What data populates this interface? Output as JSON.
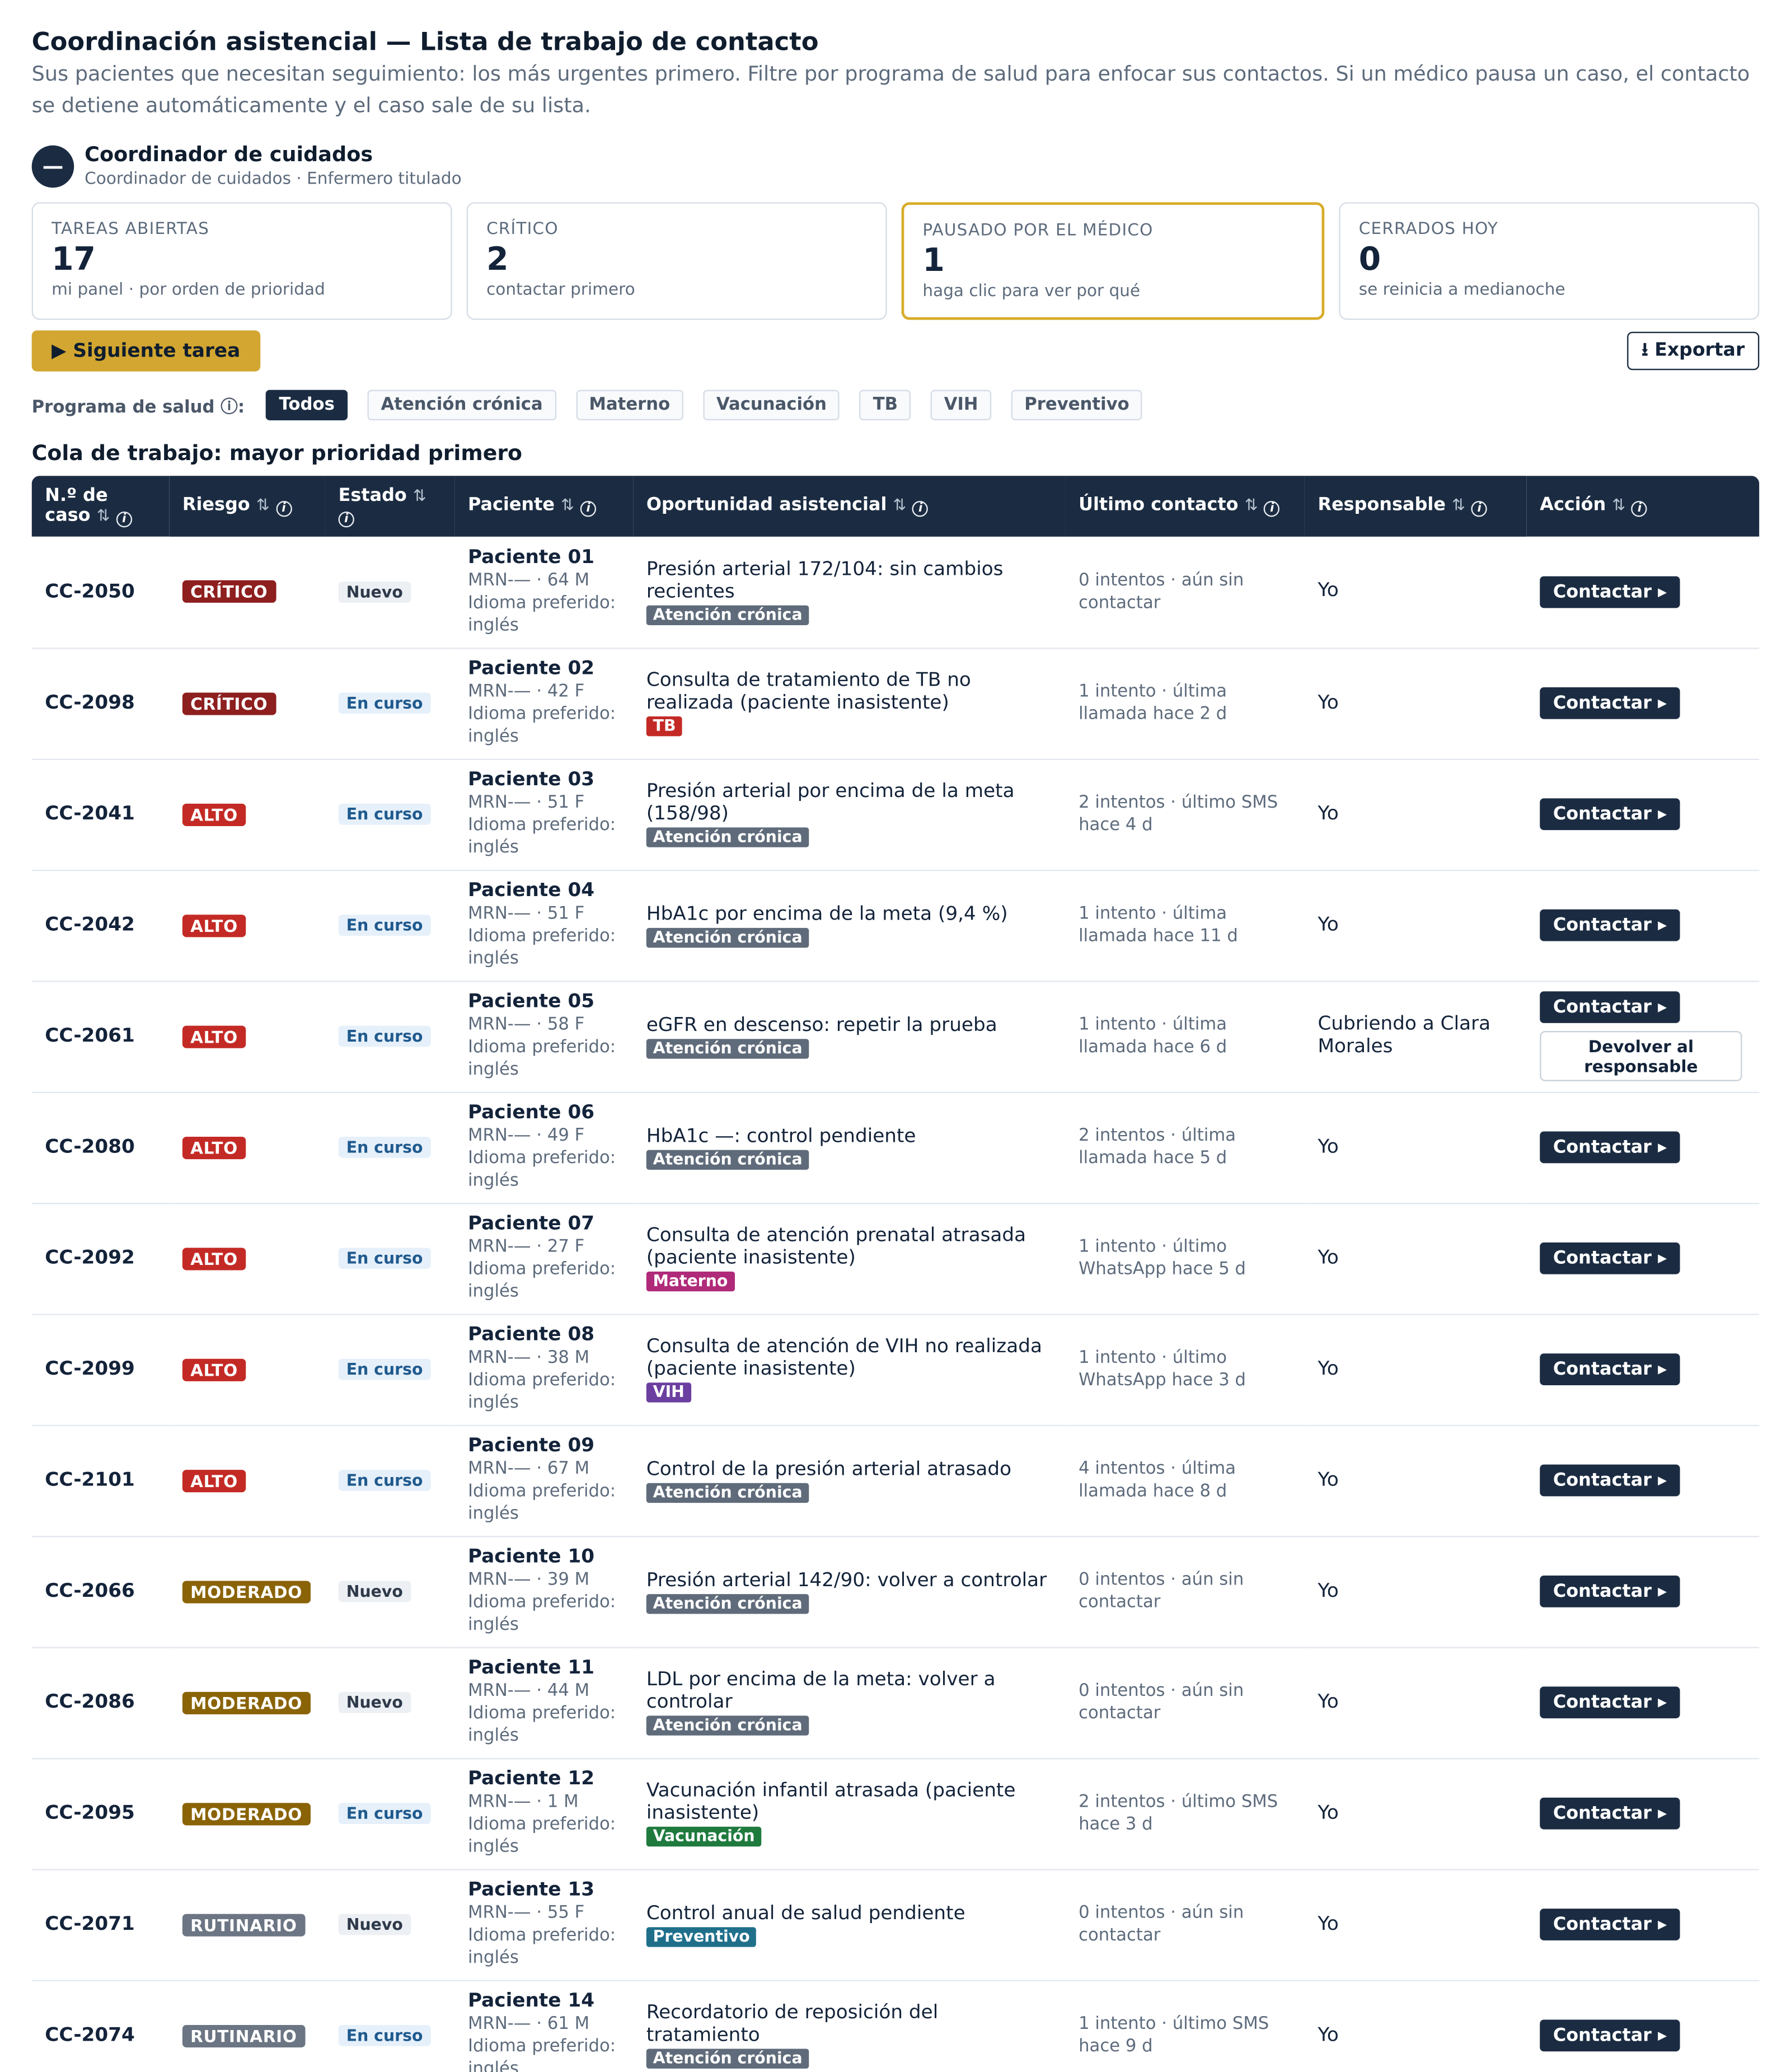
{
  "header": {
    "title": "Coordinación asistencial — Lista de trabajo de contacto",
    "subtitle": "Sus pacientes que necesitan seguimiento: los más urgentes primero. Filtre por programa de salud para enfocar sus contactos. Si un médico pausa un caso, el contacto se detiene automáticamente y el caso sale de su lista."
  },
  "role": {
    "initial": "—",
    "name": "Coordinador de cuidados",
    "detail": "Coordinador de cuidados · Enfermero titulado"
  },
  "stats": [
    {
      "label": "TAREAS ABIERTAS",
      "value": "17",
      "hint": "mi panel · por orden de prioridad"
    },
    {
      "label": "CRÍTICO",
      "value": "2",
      "hint": "contactar primero"
    },
    {
      "label": "PAUSADO POR EL MÉDICO",
      "value": "1",
      "hint": "haga clic para ver por qué"
    },
    {
      "label": "CERRADOS HOY",
      "value": "0",
      "hint": "se reinicia a medianoche"
    }
  ],
  "actions": {
    "next_task": "▶ Siguiente tarea",
    "export": "⭳ Exportar"
  },
  "filters": {
    "label": "Programa de salud ⓘ:",
    "chips": [
      "Todos",
      "Atención crónica",
      "Materno",
      "Vacunación",
      "TB",
      "VIH",
      "Preventivo"
    ],
    "active": "Todos"
  },
  "queue_title": "Cola de trabajo: mayor prioridad primero",
  "table": {
    "headers": {
      "case": "N.º de caso",
      "risk": "Riesgo",
      "status": "Estado",
      "patient": "Paciente",
      "opportunity": "Oportunidad asistencial",
      "last_contact": "Último contacto",
      "owner": "Responsable",
      "action": "Acción"
    },
    "sort_glyph": "⇅",
    "info_glyph": "i",
    "contact_label": "Contactar ▸",
    "return_label": "Devolver al responsable",
    "program_colors": {
      "Atención crónica": "#5f6b7a",
      "TB": "#c42a25",
      "Materno": "#b02a7a",
      "VIH": "#6b3fa0",
      "Vacunación": "#1f7a3e",
      "Preventivo": "#1f6f8b"
    },
    "rows": [
      {
        "case": "CC-2050",
        "risk": "CRÍTICO",
        "risk_class": "critico",
        "status": "Nuevo",
        "status_class": "nuevo",
        "patient": "Paciente 01",
        "mrn": "MRN-— · 64 M",
        "lang": "Idioma preferido: inglés",
        "opportunity": "Presión arterial 172/104: sin cambios recientes",
        "program": "Atención crónica",
        "last_contact": "0 intentos · aún sin contactar",
        "owner": "Yo"
      },
      {
        "case": "CC-2098",
        "risk": "CRÍTICO",
        "risk_class": "critico",
        "status": "En curso",
        "status_class": "curso",
        "patient": "Paciente 02",
        "mrn": "MRN-— · 42 F",
        "lang": "Idioma preferido: inglés",
        "opportunity": "Consulta de tratamiento de TB no realizada (paciente inasistente)",
        "program": "TB",
        "last_contact": "1 intento · última llamada hace 2 d",
        "owner": "Yo"
      },
      {
        "case": "CC-2041",
        "risk": "ALTO",
        "risk_class": "alto",
        "status": "En curso",
        "status_class": "curso",
        "patient": "Paciente 03",
        "mrn": "MRN-— · 51 F",
        "lang": "Idioma preferido: inglés",
        "opportunity": "Presión arterial por encima de la meta (158/98)",
        "program": "Atención crónica",
        "last_contact": "2 intentos · último SMS hace 4 d",
        "owner": "Yo"
      },
      {
        "case": "CC-2042",
        "risk": "ALTO",
        "risk_class": "alto",
        "status": "En curso",
        "status_class": "curso",
        "patient": "Paciente 04",
        "mrn": "MRN-— · 51 F",
        "lang": "Idioma preferido: inglés",
        "opportunity": "HbA1c por encima de la meta (9,4 %)",
        "program": "Atención crónica",
        "last_contact": "1 intento · última llamada hace 11 d",
        "owner": "Yo"
      },
      {
        "case": "CC-2061",
        "risk": "ALTO",
        "risk_class": "alto",
        "status": "En curso",
        "status_class": "curso",
        "patient": "Paciente 05",
        "mrn": "MRN-— · 58 F",
        "lang": "Idioma preferido: inglés",
        "opportunity": "eGFR en descenso: repetir la prueba",
        "program": "Atención crónica",
        "last_contact": "1 intento · última llamada hace 6 d",
        "owner": "Cubriendo a Clara Morales",
        "covering": true
      },
      {
        "case": "CC-2080",
        "risk": "ALTO",
        "risk_class": "alto",
        "status": "En curso",
        "status_class": "curso",
        "patient": "Paciente 06",
        "mrn": "MRN-— · 49 F",
        "lang": "Idioma preferido: inglés",
        "opportunity": "HbA1c —: control pendiente",
        "program": "Atención crónica",
        "last_contact": "2 intentos · última llamada hace 5 d",
        "owner": "Yo"
      },
      {
        "case": "CC-2092",
        "risk": "ALTO",
        "risk_class": "alto",
        "status": "En curso",
        "status_class": "curso",
        "patient": "Paciente 07",
        "mrn": "MRN-— · 27 F",
        "lang": "Idioma preferido: inglés",
        "opportunity": "Consulta de atención prenatal atrasada (paciente inasistente)",
        "program": "Materno",
        "last_contact": "1 intento · último WhatsApp hace 5 d",
        "owner": "Yo"
      },
      {
        "case": "CC-2099",
        "risk": "ALTO",
        "risk_class": "alto",
        "status": "En curso",
        "status_class": "curso",
        "patient": "Paciente 08",
        "mrn": "MRN-— · 38 M",
        "lang": "Idioma preferido: inglés",
        "opportunity": "Consulta de atención de VIH no realizada (paciente inasistente)",
        "program": "VIH",
        "last_contact": "1 intento · último WhatsApp hace 3 d",
        "owner": "Yo"
      },
      {
        "case": "CC-2101",
        "risk": "ALTO",
        "risk_class": "alto",
        "status": "En curso",
        "status_class": "curso",
        "patient": "Paciente 09",
        "mrn": "MRN-— · 67 M",
        "lang": "Idioma preferido: inglés",
        "opportunity": "Control de la presión arterial atrasado",
        "program": "Atención crónica",
        "last_contact": "4 intentos · última llamada hace 8 d",
        "owner": "Yo"
      },
      {
        "case": "CC-2066",
        "risk": "MODERADO",
        "risk_class": "moderado",
        "status": "Nuevo",
        "status_class": "nuevo",
        "patient": "Paciente 10",
        "mrn": "MRN-— · 39 M",
        "lang": "Idioma preferido: inglés",
        "opportunity": "Presión arterial 142/90: volver a controlar",
        "program": "Atención crónica",
        "last_contact": "0 intentos · aún sin contactar",
        "owner": "Yo"
      },
      {
        "case": "CC-2086",
        "risk": "MODERADO",
        "risk_class": "moderado",
        "status": "Nuevo",
        "status_class": "nuevo",
        "patient": "Paciente 11",
        "mrn": "MRN-— · 44 M",
        "lang": "Idioma preferido: inglés",
        "opportunity": "LDL por encima de la meta: volver a controlar",
        "program": "Atención crónica",
        "last_contact": "0 intentos · aún sin contactar",
        "owner": "Yo"
      },
      {
        "case": "CC-2095",
        "risk": "MODERADO",
        "risk_class": "moderado",
        "status": "En curso",
        "status_class": "curso",
        "patient": "Paciente 12",
        "mrn": "MRN-— · 1 M",
        "lang": "Idioma preferido: inglés",
        "opportunity": "Vacunación infantil atrasada (paciente inasistente)",
        "program": "Vacunación",
        "last_contact": "2 intentos · último SMS hace 3 d",
        "owner": "Yo"
      },
      {
        "case": "CC-2071",
        "risk": "RUTINARIO",
        "risk_class": "rutinario",
        "status": "Nuevo",
        "status_class": "nuevo",
        "patient": "Paciente 13",
        "mrn": "MRN-— · 55 F",
        "lang": "Idioma preferido: inglés",
        "opportunity": "Control anual de salud pendiente",
        "program": "Preventivo",
        "last_contact": "0 intentos · aún sin contactar",
        "owner": "Yo"
      },
      {
        "case": "CC-2074",
        "risk": "RUTINARIO",
        "risk_class": "rutinario",
        "status": "En curso",
        "status_class": "curso",
        "patient": "Paciente 14",
        "mrn": "MRN-— · 61 M",
        "lang": "Idioma preferido: inglés",
        "opportunity": "Recordatorio de reposición del tratamiento",
        "program": "Atención crónica",
        "last_contact": "1 intento · último SMS hace 9 d",
        "owner": "Yo"
      }
    ]
  }
}
